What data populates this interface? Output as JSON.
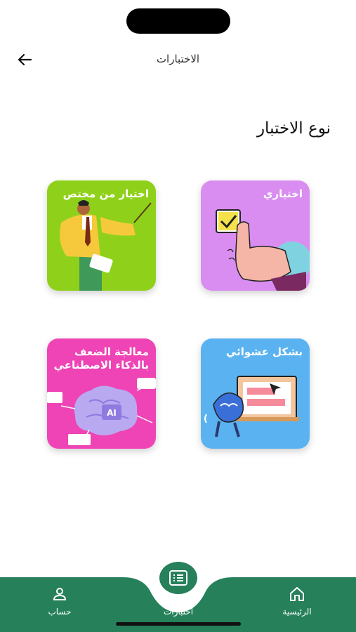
{
  "header": {
    "title": "الاختبارات"
  },
  "section": {
    "title": "نوع الاختبار"
  },
  "cards": [
    {
      "label": "اختيار من مختص",
      "color": "#8fd11a",
      "icon": "teacher-illustration"
    },
    {
      "label": "اختياري",
      "color": "#d98df0",
      "icon": "checkbox-hand-illustration"
    },
    {
      "label": "معالجة الضعف بالذكاء الاصطناعي",
      "color": "#ee44b5",
      "icon": "ai-brain-illustration",
      "badge": "AI"
    },
    {
      "label": "بشكل عشوائي",
      "color": "#5ab3f0",
      "icon": "random-screen-illustration"
    }
  ],
  "nav": {
    "account": "حساب",
    "tests": "اختبارات",
    "home": "الرئيسية",
    "bg_color": "#26805a"
  }
}
